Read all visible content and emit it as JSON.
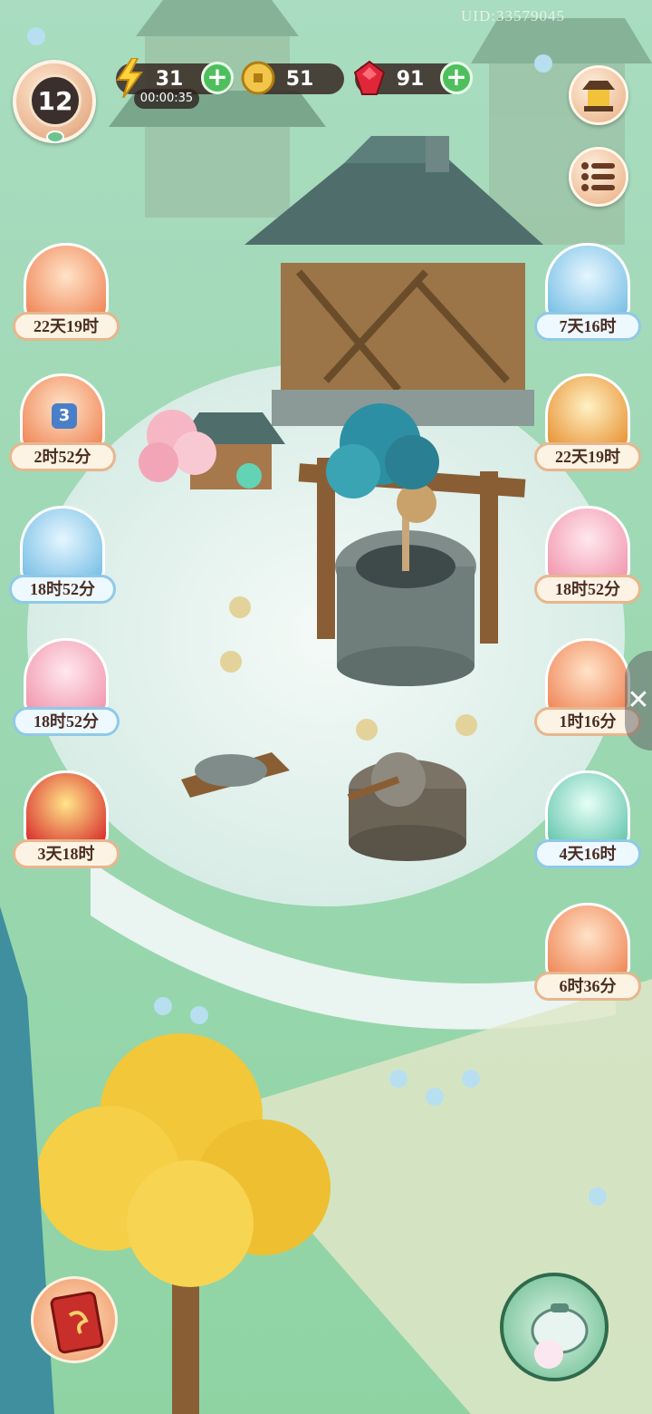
{
  "uid": "UID:33579045",
  "player": {
    "level": "12"
  },
  "resources": {
    "energy": {
      "value": "31",
      "timer": "00:00:35",
      "icon": "lightning-icon"
    },
    "coins": {
      "value": "51",
      "icon": "coin-icon"
    },
    "gems": {
      "value": "91",
      "icon": "ruby-icon"
    }
  },
  "left_events": [
    {
      "label": "22天19时",
      "icon": "wedding-chest-icon"
    },
    {
      "label": "2时52分",
      "icon": "gift-box-icon",
      "badge": "3"
    },
    {
      "label": "18时52分",
      "icon": "camellia-flower-icon"
    },
    {
      "label": "18时52分",
      "icon": "pink-fan-icon"
    },
    {
      "label": "3天18时",
      "icon": "gold-coin-drum-icon"
    }
  ],
  "right_events": [
    {
      "label": "7天16时",
      "icon": "cat-on-cloud-icon"
    },
    {
      "label": "22天19时",
      "icon": "red-envelope-mirror-icon"
    },
    {
      "label": "18时52分",
      "icon": "cream-cat-icon"
    },
    {
      "label": "1时16分",
      "icon": "treasure-box-icon"
    },
    {
      "label": "4天16时",
      "icon": "cat-gift-icon"
    },
    {
      "label": "6时36分",
      "icon": "girl-character-icon"
    }
  ],
  "colors": {
    "accent_green": "#4fbf5e",
    "label_border": "#e7b68e",
    "hud_dark": "#372823"
  }
}
